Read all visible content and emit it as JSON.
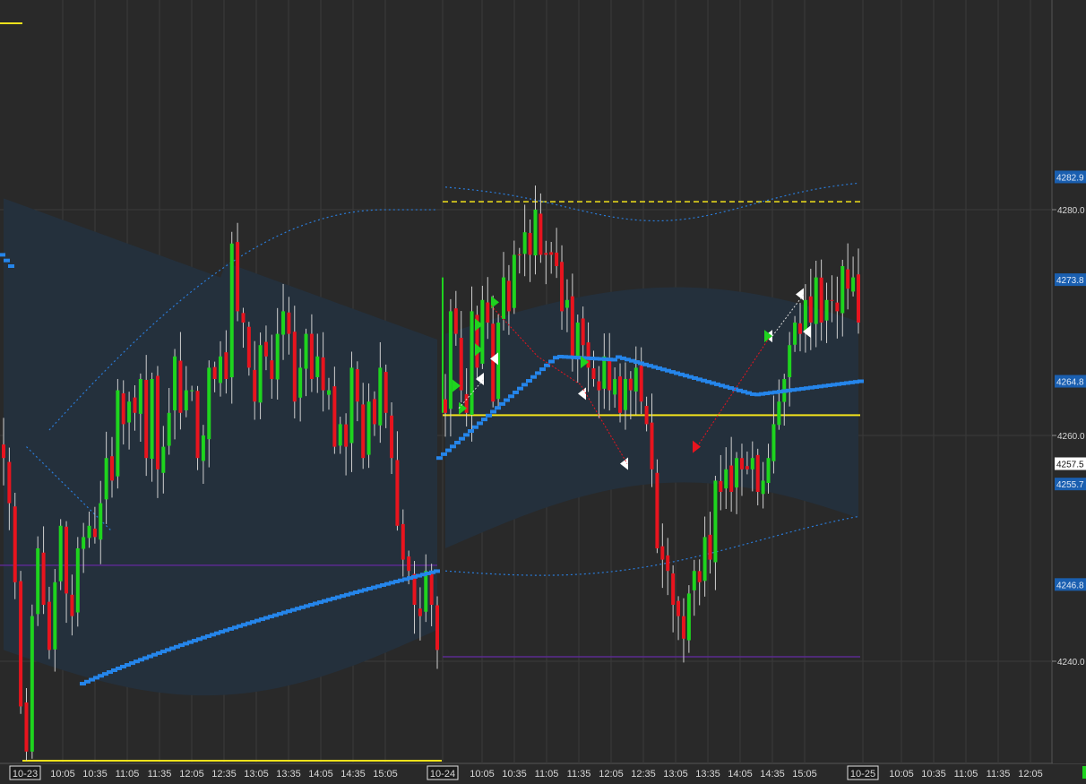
{
  "chart_data": {
    "type": "candlestick",
    "colors": {
      "background": "#292929",
      "grid": "#3a3a3a",
      "up": "#1ed41e",
      "down": "#e8141e",
      "wick": "#cfcfcf",
      "band": "#24303c",
      "vwap": "#2585ea",
      "bands_dotted": "#2a7bd8",
      "yellow": "#f2e21b",
      "purple": "#5a2a90",
      "price_label_bg": "#1a5fb0",
      "last_label_bg": "#ffffff",
      "arrow_buy": "#1ed41e",
      "arrow_sell": "#ffffff",
      "arrow_red": "#e8141e"
    },
    "ylim": [
      4233,
      4303
    ],
    "y_ticks": [
      {
        "value": 4240,
        "label": "4240.0"
      },
      {
        "value": 4260,
        "label": "4260.0"
      },
      {
        "value": 4280,
        "label": "4280.0"
      }
    ],
    "y_price_labels": [
      {
        "value": 4282.9,
        "label": "4282.9",
        "style": "blue"
      },
      {
        "value": 4273.8,
        "label": "4273.8",
        "style": "blue"
      },
      {
        "value": 4264.8,
        "label": "4264.8",
        "style": "blue"
      },
      {
        "value": 4257.5,
        "label": "4257.5",
        "style": "last"
      },
      {
        "value": 4255.7,
        "label": "4255.7",
        "style": "blue"
      },
      {
        "value": 4246.8,
        "label": "4246.8",
        "style": "blue"
      }
    ],
    "x_labels": [
      {
        "label": "10-23",
        "boxed": true
      },
      {
        "label": "10:05"
      },
      {
        "label": "10:35"
      },
      {
        "label": "11:05"
      },
      {
        "label": "11:35"
      },
      {
        "label": "12:05"
      },
      {
        "label": "12:35"
      },
      {
        "label": "13:05"
      },
      {
        "label": "13:35"
      },
      {
        "label": "14:05"
      },
      {
        "label": "14:35"
      },
      {
        "label": "15:05"
      },
      {
        "label": "10-24",
        "boxed": true
      },
      {
        "label": "10:05"
      },
      {
        "label": "10:35"
      },
      {
        "label": "11:05"
      },
      {
        "label": "11:35"
      },
      {
        "label": "12:05"
      },
      {
        "label": "12:35"
      },
      {
        "label": "13:05"
      },
      {
        "label": "13:35"
      },
      {
        "label": "14:05"
      },
      {
        "label": "14:35"
      },
      {
        "label": "15:05"
      },
      {
        "label": "10-25",
        "boxed": true
      },
      {
        "label": "10:05"
      },
      {
        "label": "10:35"
      },
      {
        "label": "11:05"
      },
      {
        "label": "11:35"
      },
      {
        "label": "12:05"
      }
    ],
    "day1_closes": [
      4258,
      4254,
      4247,
      4236,
      4232,
      4244,
      4250,
      4245,
      4241,
      4247,
      4252,
      4246,
      4244,
      4250,
      4251,
      4252,
      4251,
      4254,
      4258,
      4256,
      4264,
      4261,
      4263,
      4262,
      4265,
      4258,
      4265,
      4257,
      4259,
      4262,
      4267,
      4262,
      4264,
      4264,
      4258,
      4260,
      4266,
      4265,
      4267,
      4265,
      4277,
      4271,
      4270,
      4266,
      4263,
      4268,
      4267,
      4265,
      4269,
      4271,
      4269,
      4263,
      4266,
      4269,
      4265,
      4267,
      4264,
      4264,
      4259,
      4261,
      4259,
      4266,
      4263,
      4258,
      4263,
      4261,
      4266,
      4262,
      4258,
      4252,
      4249,
      4248,
      4245,
      4244,
      4248,
      4245,
      4241
    ],
    "day2_closes": [
      4262,
      4271,
      4269,
      4264,
      4262,
      4271,
      4266,
      4272,
      4270,
      4263,
      4270,
      4274,
      4271,
      4276,
      4276,
      4278,
      4276,
      4280,
      4276,
      4276,
      4276,
      4275,
      4271,
      4272,
      4267,
      4270,
      4268,
      4266,
      4265,
      4264,
      4267,
      4264,
      4265,
      4262,
      4265,
      4264,
      4266,
      4263,
      4261,
      4257,
      4250,
      4249,
      4248,
      4245,
      4244,
      4242,
      4246,
      4248,
      4247,
      4251,
      4249,
      4256,
      4255,
      4257,
      4255,
      4258,
      4257,
      4257,
      4258,
      4255,
      4256,
      4258,
      4261,
      4263,
      4265,
      4268,
      4270,
      4269,
      4272,
      4270,
      4274,
      4270,
      4272,
      4272,
      4271,
      4275,
      4273,
      4274,
      4270
    ]
  }
}
